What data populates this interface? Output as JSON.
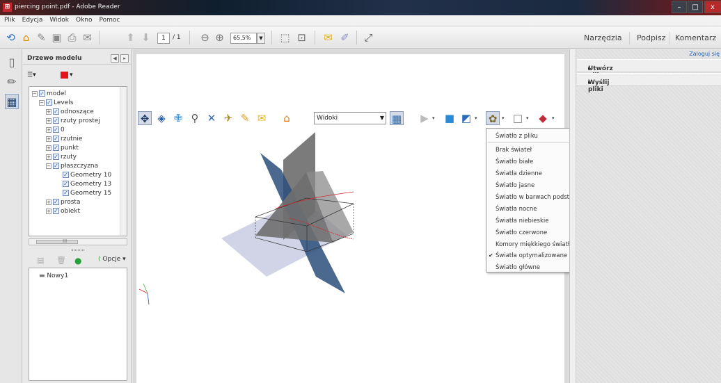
{
  "window": {
    "title": "piercing point.pdf - Adobe Reader",
    "app_icon": "pdf-icon",
    "controls": [
      "–",
      "□",
      "x"
    ]
  },
  "menu": [
    "Plik",
    "Edycja",
    "Widok",
    "Okno",
    "Pomoc"
  ],
  "toolbar": {
    "page_current": "1",
    "page_total": "/ 1",
    "zoom": "65,5%",
    "right_tabs": [
      "Narzędzia",
      "Podpisz",
      "Komentarz"
    ]
  },
  "model_tree": {
    "title": "Drzewo modelu",
    "items": [
      {
        "label": "model",
        "level": 0,
        "expander": "−"
      },
      {
        "label": "Levels",
        "level": 1,
        "expander": "−"
      },
      {
        "label": "odnoszące",
        "level": 2,
        "expander": "+"
      },
      {
        "label": "rzuty prostej",
        "level": 2,
        "expander": "+"
      },
      {
        "label": "0",
        "level": 2,
        "expander": "+"
      },
      {
        "label": "rzutnie",
        "level": 2,
        "expander": "+"
      },
      {
        "label": "punkt",
        "level": 2,
        "expander": "+"
      },
      {
        "label": "rzuty",
        "level": 2,
        "expander": "+"
      },
      {
        "label": "płaszczyzna",
        "level": 2,
        "expander": "−"
      },
      {
        "label": "Geometry 10",
        "level": 3,
        "expander": ""
      },
      {
        "label": "Geometry 13",
        "level": 3,
        "expander": ""
      },
      {
        "label": "Geometry 15",
        "level": 3,
        "expander": ""
      },
      {
        "label": "prosta",
        "level": 2,
        "expander": "+"
      },
      {
        "label": "obiekt",
        "level": 2,
        "expander": "+"
      }
    ],
    "scroll_label": "III",
    "options_label": "Opcje",
    "views": [
      "Nowy1"
    ]
  },
  "toolbar_3d": {
    "views_select": "Widoki"
  },
  "lighting_menu": {
    "items": [
      {
        "label": "Światło z pliku",
        "checked": false
      },
      {
        "label": "Brak świateł",
        "checked": false
      },
      {
        "label": "Światło białe",
        "checked": false
      },
      {
        "label": "Światła dzienne",
        "checked": false
      },
      {
        "label": "Światło jasne",
        "checked": false
      },
      {
        "label": "Światło w barwach podstawowych",
        "checked": false
      },
      {
        "label": "Światła nocne",
        "checked": false
      },
      {
        "label": "Światła niebieskie",
        "checked": false
      },
      {
        "label": "Światło czerwone",
        "checked": false
      },
      {
        "label": "Komory miękkiego światła",
        "checked": false
      },
      {
        "label": "Światła optymalizowane CAD",
        "checked": true
      },
      {
        "label": "Światło główne",
        "checked": false
      }
    ]
  },
  "right_pane": {
    "login": "Zaloguj się",
    "sections": [
      "Utwórz plik PDF",
      "Wyślij pliki"
    ]
  },
  "colors": {
    "accent_red": "#e2131b",
    "plane_blue": "#2c4f7a",
    "plane_gray": "#6d6d6d",
    "ground": "#c9cbe3"
  }
}
